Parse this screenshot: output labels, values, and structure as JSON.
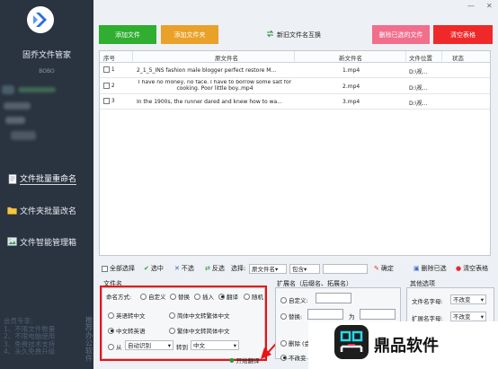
{
  "sidebar": {
    "app_name": "固乔文件管家",
    "user": "BOBO",
    "nav": [
      {
        "label": "文件批量重命名",
        "icon": "document-icon",
        "active": true
      },
      {
        "label": "文件夹批量改名",
        "icon": "folder-icon",
        "active": false
      },
      {
        "label": "文件智能管理箱",
        "icon": "image-box-icon",
        "active": false
      }
    ],
    "member_title": "会员专享:",
    "member_lines": [
      "1、不限文件数量",
      "2、不限电脑使用",
      "3、免费技术支持",
      "4、永久免费升级"
    ],
    "promo": "推荐办公软件"
  },
  "toolbar_top": {
    "add_file": "添加文件",
    "add_folder": "添加文件夹",
    "swap_label": "新旧文件名互换",
    "delete_selected": "删除已选的文件",
    "clear_table": "清空表格"
  },
  "table": {
    "headers": {
      "seq": "序号",
      "orig": "原文件名",
      "new": "新文件名",
      "loc": "文件位置",
      "status": "状态"
    },
    "rows": [
      {
        "seq": "1",
        "orig": "2_1_5_INS fashion male blogger perfect restore M...",
        "new": "1.mp4",
        "loc": "D:\\视..."
      },
      {
        "seq": "2",
        "orig": "I have no money, no face. I have to borrow some salt for cooking. Poor little boy..mp4",
        "new": "2.mp4",
        "loc": "D:\\视..."
      },
      {
        "seq": "3",
        "orig": "In the 1900s, the runner dared and knew how to wa...",
        "new": "3.mp4",
        "loc": "D:\\视..."
      }
    ]
  },
  "toolbar_bottom": {
    "select_all": "全部选择",
    "select": "选中",
    "unselect": "不选",
    "invert": "反选",
    "choose": "选择:",
    "field_value": "原文件名",
    "match_value": "包含",
    "search_value": "",
    "confirm": "确定",
    "delete_selected": "删除已选",
    "clear_table": "清空表格"
  },
  "filename_panel": {
    "title": "文件名",
    "mode_label": "命名方式:",
    "modes": [
      "自定义",
      "替换",
      "插入",
      "翻译",
      "随机"
    ],
    "mode_selected": "翻译",
    "options": [
      "英语转中文",
      "简体中文转繁体中文",
      "中文转英语",
      "繁体中文转简体中文"
    ],
    "option_selected": "中文转英语",
    "from_label": "从",
    "from_value": "自动识别",
    "to_label": "转到",
    "to_value": "中文"
  },
  "ext_panel": {
    "title": "扩展名（后缀名、拓展名）",
    "custom": "自定义:",
    "replace": "替换:",
    "for_label": "为",
    "delete": "删除",
    "delete_extra": "(会",
    "no_change": "不改变"
  },
  "other_panel": {
    "title": "其他选项",
    "name_case_label": "文件名字母:",
    "name_case_value": "不改变",
    "ext_case_label": "扩展名字母:",
    "ext_case_value": "不改变",
    "extra_value": "不改变"
  },
  "start_button": "开始翻译",
  "watermark": "鼎品软件"
}
